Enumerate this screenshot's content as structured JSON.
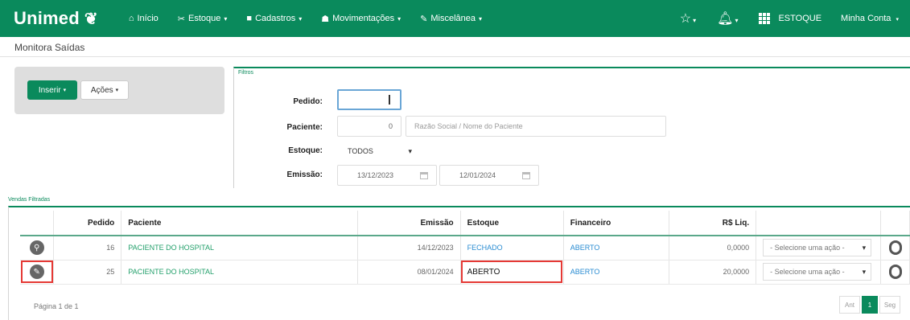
{
  "navbar": {
    "brand": "Unimed",
    "items": [
      {
        "icon": "home-icon",
        "glyph": "⌂",
        "label": "Início",
        "has_caret": false
      },
      {
        "icon": "boxes-icon",
        "glyph": "✂",
        "label": "Estoque",
        "has_caret": true
      },
      {
        "icon": "cards-icon",
        "glyph": "■",
        "label": "Cadastros",
        "has_caret": true
      },
      {
        "icon": "bank-icon",
        "glyph": "☗",
        "label": "Movimentações",
        "has_caret": true
      },
      {
        "icon": "wrench-icon",
        "glyph": "✎",
        "label": "Miscelânea",
        "has_caret": true
      }
    ],
    "star_glyph": "☆",
    "bell_glyph": "⌂",
    "module": "ESTOQUE",
    "account": "Minha Conta",
    "caret": "▾"
  },
  "page": {
    "title": "Monitora Saídas"
  },
  "actions": {
    "insert_label": "Inserir",
    "actions_label": "Ações"
  },
  "filters": {
    "legend": "Filtros",
    "pedido_label": "Pedido:",
    "paciente_label": "Paciente:",
    "paciente_code": "0",
    "paciente_placeholder": "Razão Social / Nome do Paciente",
    "estoque_label": "Estoque:",
    "estoque_value": "TODOS",
    "emissao_label": "Emissão:",
    "emissao_from": "13/12/2023",
    "emissao_to": "12/01/2024"
  },
  "results": {
    "legend": "Vendas Filtradas",
    "columns": [
      "",
      "Pedido",
      "Paciente",
      "Emissão",
      "Estoque",
      "Financeiro",
      "R$ Liq.",
      "",
      ""
    ],
    "rows": [
      {
        "icon": "search-icon",
        "glyph": "⚲",
        "pedido": "16",
        "paciente": "PACIENTE DO HOSPITAL",
        "emissao": "14/12/2023",
        "estoque": "FECHADO",
        "financeiro": "ABERTO",
        "liq": "0,0000",
        "acao": "- Selecione uma ação -"
      },
      {
        "icon": "edit-icon",
        "glyph": "✎",
        "pedido": "25",
        "paciente": "PACIENTE DO HOSPITAL",
        "emissao": "08/01/2024",
        "estoque": "ABERTO",
        "financeiro": "ABERTO",
        "liq": "20,0000",
        "acao": "- Selecione uma ação -"
      }
    ],
    "pagination_text": "Página 1 de 1",
    "prev": "Ant",
    "current": "1",
    "next": "Seg"
  },
  "colors": {
    "brand": "#0a8a5c",
    "link_green": "#23a06b",
    "link_blue": "#2a8cd2",
    "highlight": "#e53935"
  }
}
